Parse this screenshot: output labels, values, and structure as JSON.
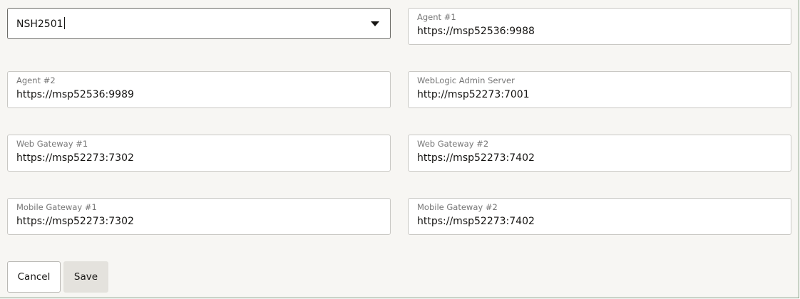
{
  "select": {
    "value": "NSH2501"
  },
  "fields": {
    "agent1": {
      "label": "Agent #1",
      "value": "https://msp52536:9988"
    },
    "agent2": {
      "label": "Agent #2",
      "value": "https://msp52536:9989"
    },
    "weblogic": {
      "label": "WebLogic Admin Server",
      "value": "http://msp52273:7001"
    },
    "web_gateway1": {
      "label": "Web Gateway #1",
      "value": "https://msp52273:7302"
    },
    "web_gateway2": {
      "label": "Web Gateway #2",
      "value": "https://msp52273:7402"
    },
    "mobile_gateway1": {
      "label": "Mobile Gateway #1",
      "value": "https://msp52273:7302"
    },
    "mobile_gateway2": {
      "label": "Mobile Gateway #2",
      "value": "https://msp52273:7402"
    }
  },
  "buttons": {
    "cancel": "Cancel",
    "save": "Save"
  }
}
